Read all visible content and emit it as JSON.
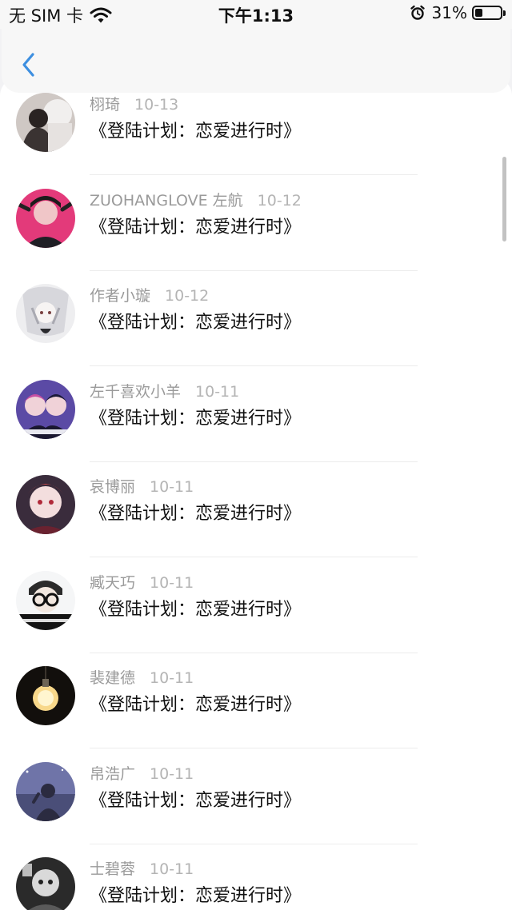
{
  "status_bar": {
    "carrier": "无 SIM 卡",
    "time": "下午1:13",
    "battery": "31%",
    "battery_level": 0.31
  },
  "nav": {
    "back_icon": "chevron-left-icon"
  },
  "colors": {
    "accent": "#3d8fe0"
  },
  "list": {
    "items": [
      {
        "name": "栩琦",
        "date": "10-13",
        "message": "《登陆计划：恋爱进行时》",
        "avatar": "avatar-photo-1"
      },
      {
        "name": "ZUOHANGLOVE 左航",
        "date": "10-12",
        "message": "《登陆计划：恋爱进行时》",
        "avatar": "avatar-photo-2"
      },
      {
        "name": "作者小璇",
        "date": "10-12",
        "message": "《登陆计划：恋爱进行时》",
        "avatar": "avatar-photo-3"
      },
      {
        "name": "左千喜欢小羊",
        "date": "10-11",
        "message": "《登陆计划：恋爱进行时》",
        "avatar": "avatar-photo-4"
      },
      {
        "name": "哀博丽",
        "date": "10-11",
        "message": "《登陆计划：恋爱进行时》",
        "avatar": "avatar-photo-5"
      },
      {
        "name": "臧天巧",
        "date": "10-11",
        "message": "《登陆计划：恋爱进行时》",
        "avatar": "avatar-photo-6"
      },
      {
        "name": "裴建德",
        "date": "10-11",
        "message": "《登陆计划：恋爱进行时》",
        "avatar": "avatar-photo-7"
      },
      {
        "name": "帛浩广",
        "date": "10-11",
        "message": "《登陆计划：恋爱进行时》",
        "avatar": "avatar-photo-8"
      },
      {
        "name": "士碧蓉",
        "date": "10-11",
        "message": "《登陆计划：恋爱进行时》",
        "avatar": "avatar-photo-9"
      }
    ]
  }
}
